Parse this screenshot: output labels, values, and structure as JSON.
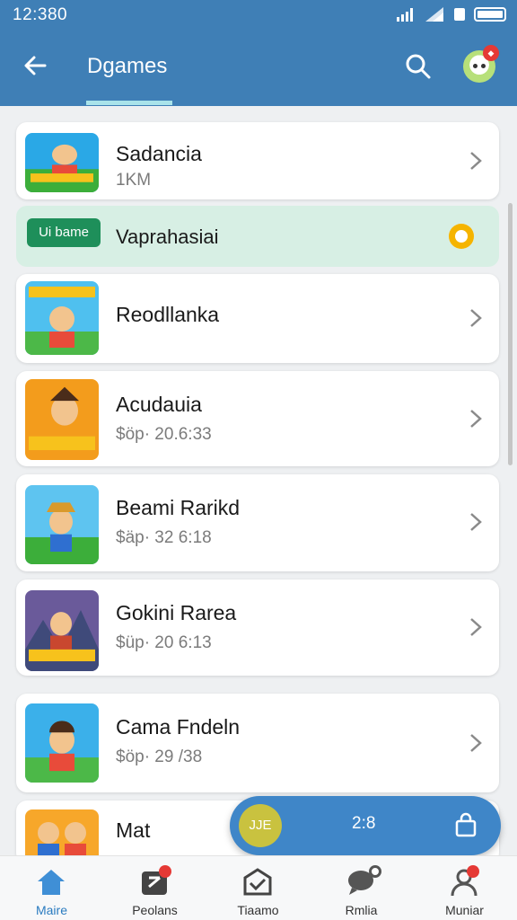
{
  "status": {
    "time": "12:380"
  },
  "header": {
    "title": "Dgames"
  },
  "highlight": {
    "badge": "Ui bame",
    "name": "Vaprahasiai"
  },
  "games": [
    {
      "name": "Sadancia",
      "sub": "1KM"
    },
    {
      "name": "Reodllanka",
      "sub": ""
    },
    {
      "name": "Acudauia",
      "sub": "$öp· 20.6:33"
    },
    {
      "name": "Beami Rarikd",
      "sub": "$äp· 32 6:18"
    },
    {
      "name": "Gokini Rarea",
      "sub": "$üp· 20 6:13"
    },
    {
      "name": "Cama Fndeln",
      "sub": "$öp· 29 /38"
    },
    {
      "name": "Mat",
      "sub": ""
    }
  ],
  "fab": {
    "coin_label": "JJE",
    "count": "2:8"
  },
  "nav": [
    {
      "label": "Maire",
      "icon": "home-icon"
    },
    {
      "label": "Peolans",
      "icon": "gamepad-icon"
    },
    {
      "label": "Tiaamo",
      "icon": "inbox-icon"
    },
    {
      "label": "Rmlia",
      "icon": "chat-icon"
    },
    {
      "label": "Muniar",
      "icon": "profile-icon"
    }
  ],
  "colors": {
    "appbar": "#3f7fb6",
    "accent": "#2a7bc0",
    "highlight": "#d7efe4",
    "badge": "#1e8f5a",
    "fab": "#3f86c8"
  }
}
